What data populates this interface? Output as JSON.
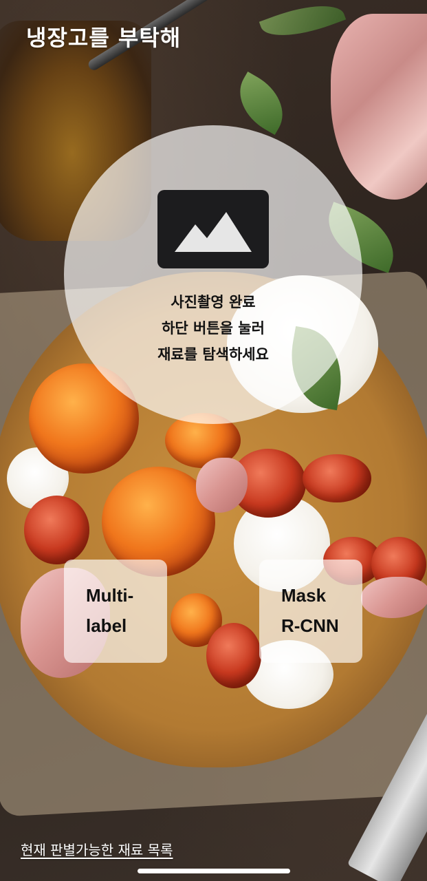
{
  "header": {
    "title": "냉장고를 부탁해"
  },
  "capture": {
    "icon": "image-icon",
    "instruction_lines": [
      "사진촬영 완료",
      "하단 버튼을 눌러",
      "재료를 탐색하세요"
    ]
  },
  "models": [
    {
      "label_lines": [
        "Multi-",
        "label"
      ]
    },
    {
      "label_lines": [
        "Mask",
        "R-CNN"
      ]
    }
  ],
  "footer": {
    "link": "현재 판별가능한 재료 목록"
  },
  "colors": {
    "overlay": "#ffffff",
    "icon": "#1c1c1e",
    "text_dark": "#111111",
    "text_light": "#ffffff"
  }
}
